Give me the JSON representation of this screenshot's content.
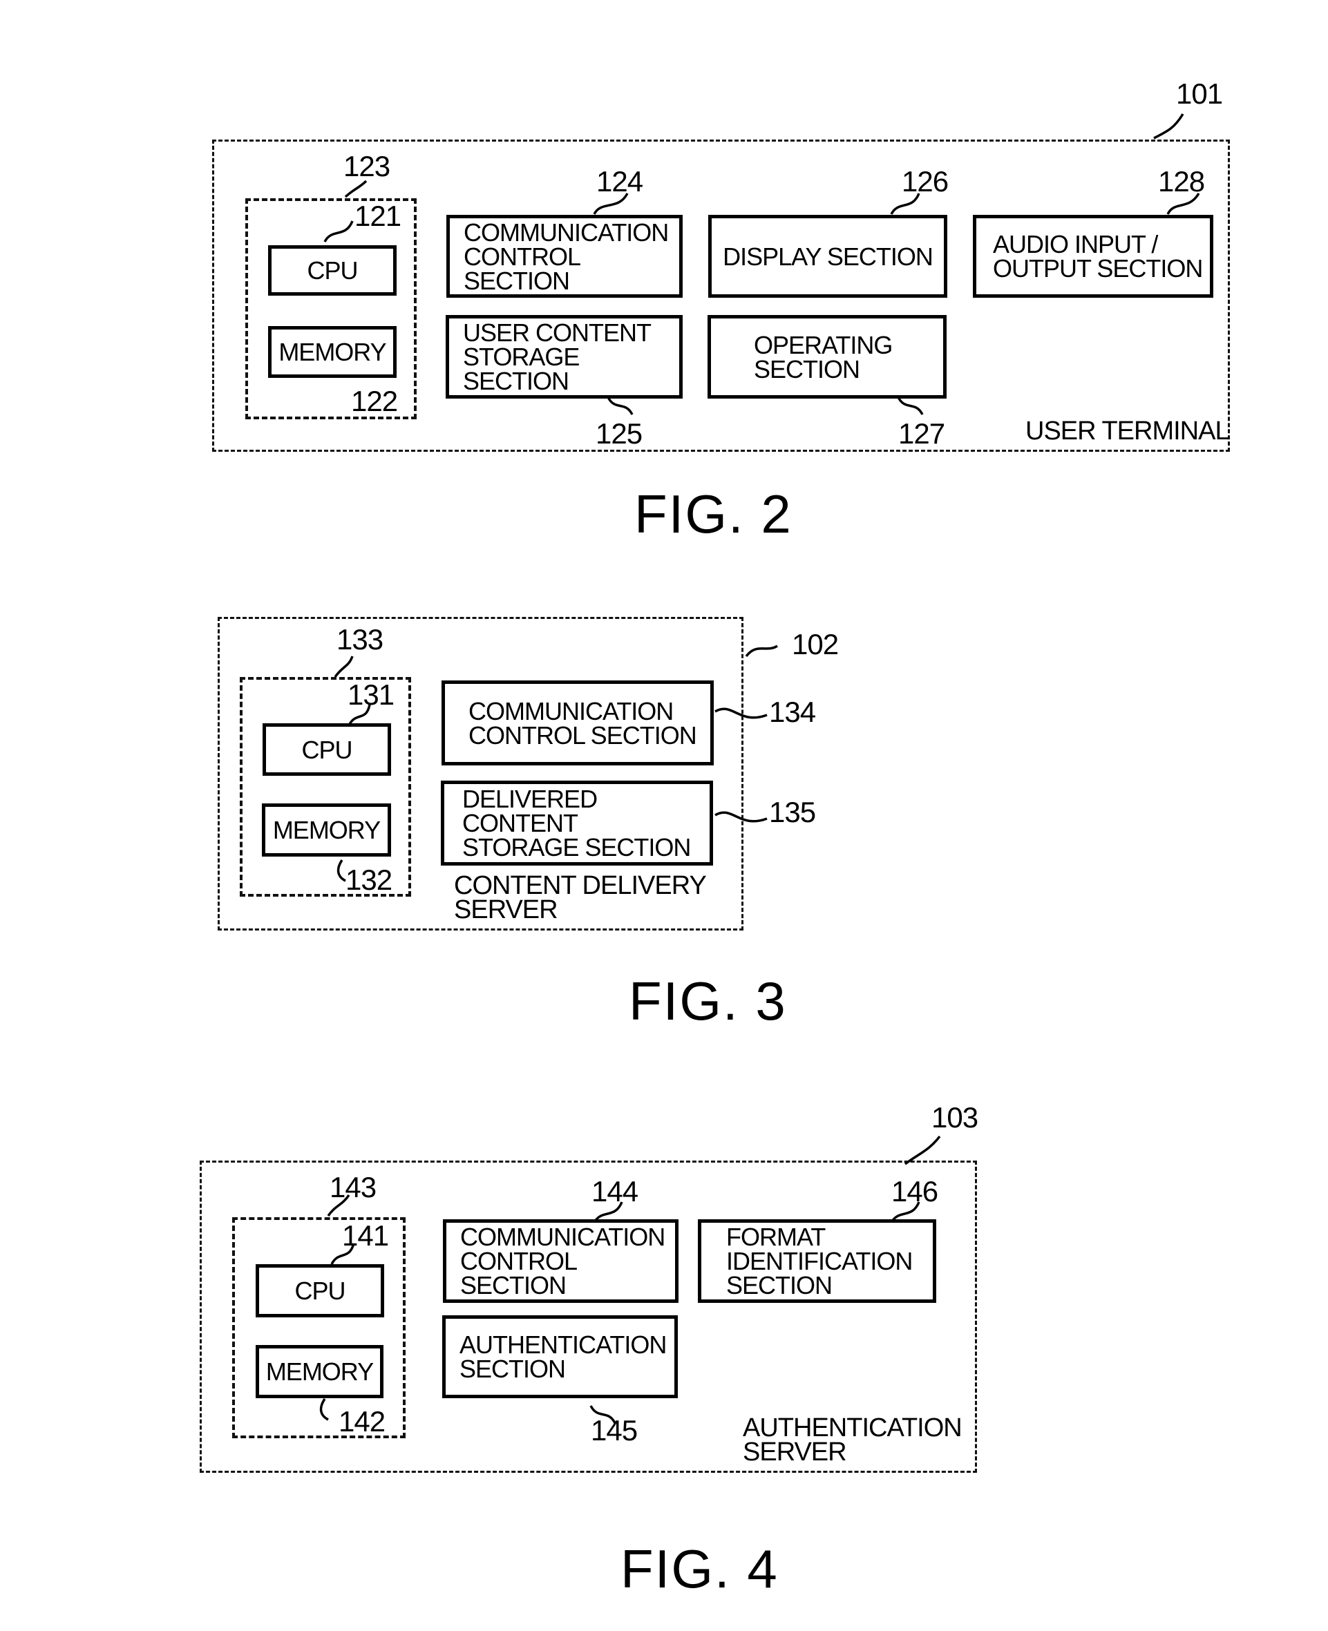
{
  "figures": [
    {
      "label": "FIG. 2",
      "container": {
        "ref": "101",
        "caption": "USER TERMINAL"
      },
      "group": {
        "ref": "123"
      },
      "cpu": {
        "ref": "121",
        "text": "CPU"
      },
      "memory": {
        "ref": "122",
        "text": "MEMORY"
      },
      "blocks": [
        {
          "ref": "124",
          "lines": [
            "COMMUNICATION",
            "CONTROL",
            "SECTION"
          ]
        },
        {
          "ref": "125",
          "lines": [
            "USER CONTENT",
            "STORAGE",
            "SECTION"
          ]
        },
        {
          "ref": "126",
          "lines": [
            "DISPLAY SECTION"
          ]
        },
        {
          "ref": "127",
          "lines": [
            "OPERATING",
            "SECTION"
          ]
        },
        {
          "ref": "128",
          "lines": [
            "AUDIO INPUT /",
            "OUTPUT SECTION"
          ]
        }
      ]
    },
    {
      "label": "FIG. 3",
      "container": {
        "ref": "102",
        "caption_lines": [
          "CONTENT DELIVERY",
          "SERVER"
        ]
      },
      "group": {
        "ref": "133"
      },
      "cpu": {
        "ref": "131",
        "text": "CPU"
      },
      "memory": {
        "ref": "132",
        "text": "MEMORY"
      },
      "blocks": [
        {
          "ref": "134",
          "lines": [
            "COMMUNICATION",
            "CONTROL SECTION"
          ]
        },
        {
          "ref": "135",
          "lines": [
            "DELIVERED",
            "CONTENT",
            "STORAGE SECTION"
          ]
        }
      ]
    },
    {
      "label": "FIG. 4",
      "container": {
        "ref": "103",
        "caption_lines": [
          "AUTHENTICATION",
          "SERVER"
        ]
      },
      "group": {
        "ref": "143"
      },
      "cpu": {
        "ref": "141",
        "text": "CPU"
      },
      "memory": {
        "ref": "142",
        "text": "MEMORY"
      },
      "blocks": [
        {
          "ref": "144",
          "lines": [
            "COMMUNICATION",
            "CONTROL",
            "SECTION"
          ]
        },
        {
          "ref": "145",
          "lines": [
            "AUTHENTICATION",
            "SECTION"
          ]
        },
        {
          "ref": "146",
          "lines": [
            "FORMAT",
            "IDENTIFICATION",
            "SECTION"
          ]
        }
      ]
    }
  ]
}
